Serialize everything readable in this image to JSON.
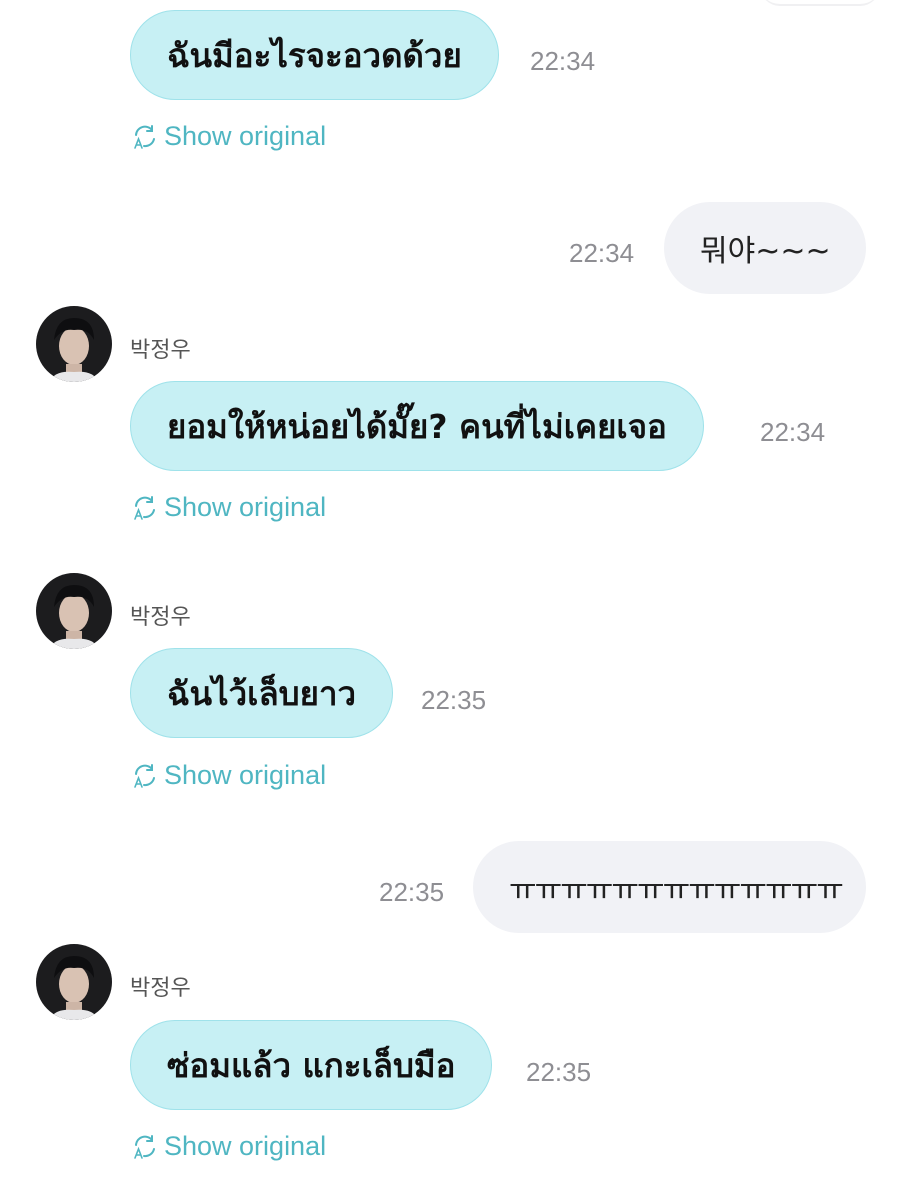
{
  "colors": {
    "incoming_bubble": "#c7f0f4",
    "outgoing_bubble": "#f1f2f6",
    "accent": "#4fb6c2",
    "timestamp": "#8e8e93"
  },
  "show_original_label": "Show original",
  "translate_icon": "translate-refresh-icon",
  "messages": [
    {
      "direction": "in",
      "sender": "",
      "text": "ฉันมีอะไรจะอวดด้วย",
      "time": "22:34",
      "show_original": "Show original"
    },
    {
      "direction": "out",
      "text": "뭐야~~~",
      "time": "22:34"
    },
    {
      "direction": "in",
      "sender": "박정우",
      "text": "ยอมให้หน่อยได้มั๊ย? คนที่ไม่เคยเจอ",
      "time": "22:34",
      "show_original": "Show original"
    },
    {
      "direction": "in",
      "sender": "박정우",
      "text": "ฉันไว้เล็บยาว",
      "time": "22:35",
      "show_original": "Show original"
    },
    {
      "direction": "out",
      "text": "ㅠㅠㅠㅠㅠㅠㅠㅠㅠㅠㅠㅠㅠ",
      "time": "22:35"
    },
    {
      "direction": "in",
      "sender": "박정우",
      "text": "ซ่อมแล้ว แกะเล็บมือ",
      "time": "22:35",
      "show_original": "Show original"
    }
  ]
}
